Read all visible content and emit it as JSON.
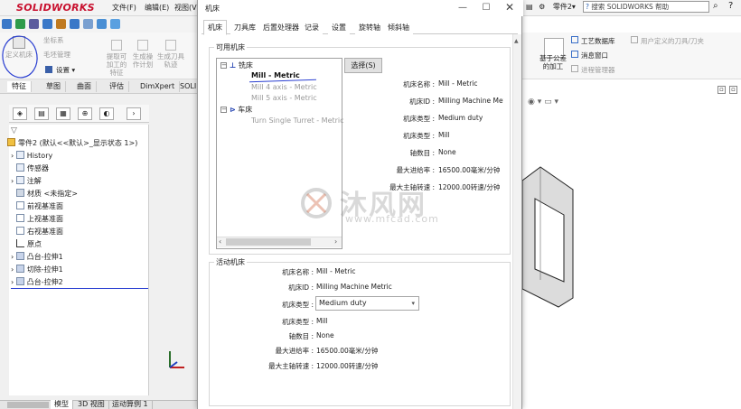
{
  "app": {
    "logo": "SOLIDWORKS",
    "menu": [
      "文件(F)",
      "编辑(E)",
      "视图(V)"
    ],
    "right_toolbar": {
      "doc_name": "零件2",
      "search_placeholder": "搜索 SOLIDWORKS 帮助"
    },
    "command_manager": {
      "items": [
        {
          "label": "坐标系"
        },
        {
          "label": "定义机床"
        },
        {
          "label": "毛坯管理"
        },
        {
          "label": "设置"
        },
        {
          "label": "提取可加工的特征"
        },
        {
          "label": "生成操作计划"
        },
        {
          "label": "生成刀具轨迹"
        }
      ],
      "right_items": [
        {
          "label": "工艺数据库"
        },
        {
          "label": "用户定义的刀具/刀夹"
        },
        {
          "label": "消息窗口"
        },
        {
          "label": "进程管理器"
        },
        {
          "label": "基于公差的加工"
        }
      ],
      "tabs": [
        "特征",
        "草图",
        "曲面",
        "评估",
        "DimXpert",
        "SOLID"
      ]
    },
    "feature_tree": {
      "root": "零件2 (默认<<默认>_显示状态 1>)",
      "items": [
        {
          "label": "History"
        },
        {
          "label": "传感器"
        },
        {
          "label": "注解"
        },
        {
          "label": "材质 <未指定>"
        },
        {
          "label": "前视基准面"
        },
        {
          "label": "上视基准面"
        },
        {
          "label": "右视基准面"
        },
        {
          "label": "原点"
        },
        {
          "label": "凸台-拉伸1"
        },
        {
          "label": "切除-拉伸1"
        },
        {
          "label": "凸台-拉伸2"
        }
      ]
    },
    "bottom_tabs": [
      "模型",
      "3D 视图",
      "运动算例 1"
    ]
  },
  "dialog": {
    "title": "机床",
    "tabs": [
      "机床",
      "刀具库",
      "后置处理器",
      "记录",
      "设置",
      "旋转轴",
      "倾斜轴"
    ],
    "available_group": "可用机床",
    "tree": {
      "mill_group": "铣床",
      "mill_items": [
        "Mill - Metric",
        "Mill 4 axis - Metric",
        "Mill 5 axis - Metric"
      ],
      "lathe_group": "车床",
      "lathe_items": [
        "Turn Single Turret - Metric"
      ]
    },
    "select_button": "选择(S)",
    "available_props": [
      {
        "label": "机床名称 :",
        "value": "Mill - Metric"
      },
      {
        "label": "机床ID :",
        "value": "Milling Machine Met"
      },
      {
        "label": "机床类型 :",
        "value": "Medium duty"
      },
      {
        "label": "机床类型 :",
        "value": "Mill"
      },
      {
        "label": "轴数目 :",
        "value": "None"
      },
      {
        "label": "最大进给率 :",
        "value": "16500.00毫米/分钟"
      },
      {
        "label": "最大主轴转速 :",
        "value": "12000.00转速/分钟"
      }
    ],
    "active_group": "活动机床",
    "active_props": {
      "name": {
        "label": "机床名称 :",
        "value": "Mill - Metric"
      },
      "id": {
        "label": "机床ID :",
        "value": "Milling Machine Metric"
      },
      "duty": {
        "label": "机床类型 :",
        "value": "Medium duty"
      },
      "type": {
        "label": "机床类型 :",
        "value": "Mill"
      },
      "axes": {
        "label": "轴数目 :",
        "value": "None"
      },
      "feed": {
        "label": "最大进给率 :",
        "value": "16500.00毫米/分钟"
      },
      "spindle": {
        "label": "最大主轴转速 :",
        "value": "12000.00转速/分钟"
      }
    }
  },
  "watermark": {
    "text": "沐风网",
    "url": "www.mfcad.com"
  },
  "colors": {
    "accent": "#c8102e",
    "highlight": "#1f3fb0",
    "annotation": "#2a3fd1"
  }
}
